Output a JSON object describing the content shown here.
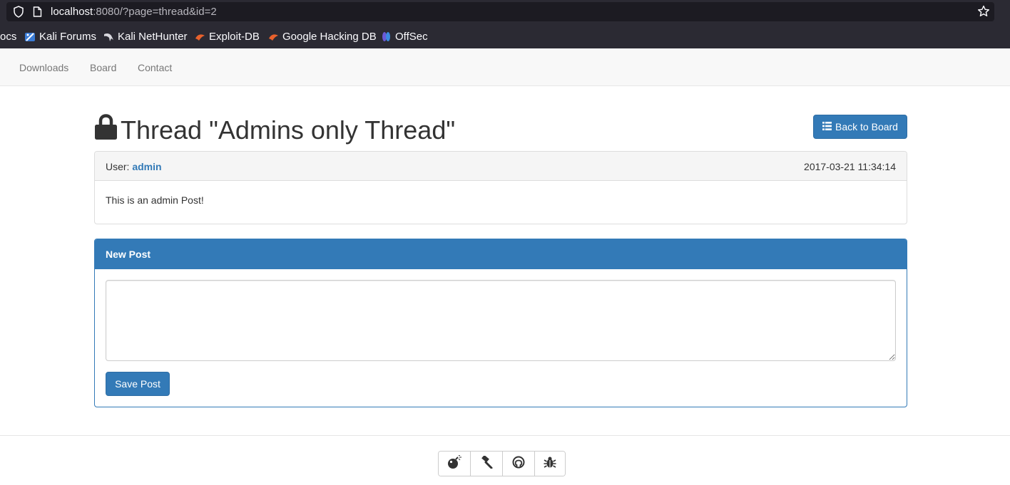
{
  "browser": {
    "url_host": "localhost",
    "url_rest": ":8080/?page=thread&id=2",
    "bookmarks": [
      {
        "label": "ocs"
      },
      {
        "label": "Kali Forums"
      },
      {
        "label": "Kali NetHunter"
      },
      {
        "label": "Exploit-DB"
      },
      {
        "label": "Google Hacking DB"
      },
      {
        "label": "OffSec"
      }
    ]
  },
  "nav": {
    "items": [
      {
        "label": "Downloads"
      },
      {
        "label": "Board"
      },
      {
        "label": "Contact"
      }
    ]
  },
  "thread": {
    "title": "Thread \"Admins only Thread\"",
    "back_label": "Back to Board",
    "post": {
      "user_prefix": "User:",
      "user": "admin",
      "date": "2017-03-21 11:34:14",
      "body": "This is an admin Post!"
    }
  },
  "new_post": {
    "heading": "New Post",
    "textarea_value": "",
    "save_label": "Save Post"
  },
  "footer": {
    "icons": [
      "bomb-icon",
      "gavel-icon",
      "github-icon",
      "bug-icon"
    ]
  },
  "colors": {
    "primary": "#337ab7",
    "chrome_bg": "#2b2a33",
    "navbar_bg": "#f8f8f8"
  }
}
